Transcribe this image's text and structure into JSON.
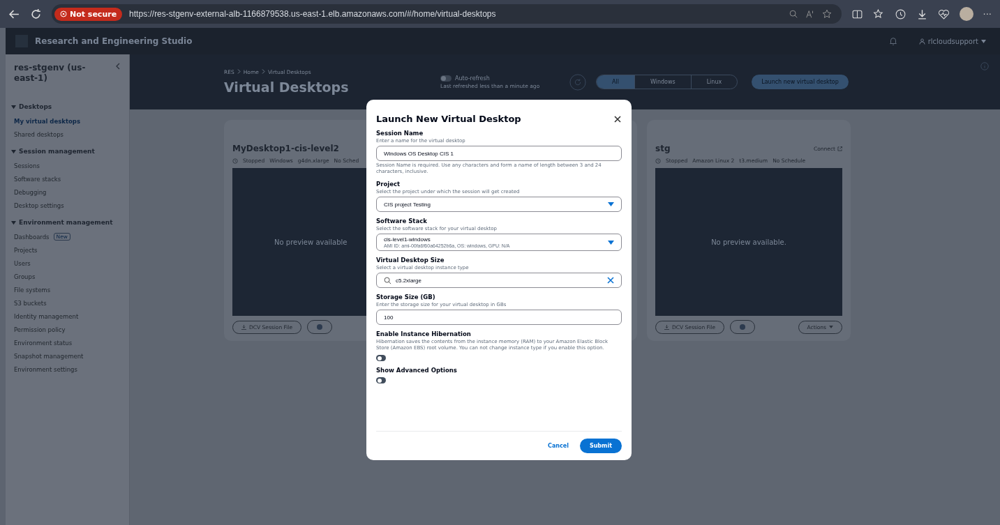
{
  "browser": {
    "security_badge": "Not secure",
    "url": "https://res-stgenv-external-alb-1166879538.us-east-1.elb.amazonaws.com/#/home/virtual-desktops",
    "more": "···"
  },
  "app_header": {
    "title": "Research and Engineering Studio",
    "user": "rlcloudsupport"
  },
  "sidebar": {
    "title": "res-stgenv (us-east-1)",
    "sections": [
      {
        "label": "Desktops",
        "expanded": true,
        "items": [
          {
            "label": "My virtual desktops",
            "selected": true
          },
          {
            "label": "Shared desktops",
            "selected": false
          }
        ]
      },
      {
        "label": "Session management",
        "expanded": true,
        "items": [
          {
            "label": "Sessions",
            "selected": false
          },
          {
            "label": "Software stacks",
            "selected": false
          },
          {
            "label": "Debugging",
            "selected": false
          },
          {
            "label": "Desktop settings",
            "selected": false
          }
        ]
      },
      {
        "label": "Environment management",
        "expanded": true,
        "items": [
          {
            "label": "Dashboards",
            "badge": "New",
            "selected": false
          },
          {
            "label": "Projects",
            "selected": false
          },
          {
            "label": "Users",
            "selected": false
          },
          {
            "label": "Groups",
            "selected": false
          },
          {
            "label": "File systems",
            "selected": false
          },
          {
            "label": "S3 buckets",
            "selected": false
          },
          {
            "label": "Identity management",
            "selected": false
          },
          {
            "label": "Permission policy",
            "selected": false
          },
          {
            "label": "Environment status",
            "selected": false
          },
          {
            "label": "Snapshot management",
            "selected": false
          },
          {
            "label": "Environment settings",
            "selected": false
          }
        ]
      }
    ]
  },
  "page": {
    "breadcrumb": [
      "RES",
      "Home",
      "Virtual Desktops"
    ],
    "title": "Virtual Desktops",
    "auto_refresh": {
      "label": "Auto-refresh",
      "note": "Last refreshed less than a minute ago",
      "on": false
    },
    "filters": [
      {
        "label": "All",
        "selected": true
      },
      {
        "label": "Windows",
        "selected": false
      },
      {
        "label": "Linux",
        "selected": false
      }
    ],
    "launch_button": "Launch new virtual desktop"
  },
  "desktops": [
    {
      "name": "MyDesktop1-cis-level2",
      "status": "Stopped",
      "meta": [
        "Windows",
        "g4dn.xlarge",
        "No Sched"
      ],
      "preview": "No preview available",
      "download": "DCV Session File"
    },
    {
      "name": "stg",
      "connect": "Connect",
      "status": "Stopped",
      "meta": [
        "Amazon Linux 2",
        "t3.medium",
        "No Schedule"
      ],
      "preview": "No preview available.",
      "download": "DCV Session File",
      "actions": "Actions"
    }
  ],
  "dialog": {
    "title": "Launch New Virtual Desktop",
    "fields": [
      {
        "kind": "text",
        "label": "Session Name",
        "description": "Enter a name for the virtual desktop",
        "value": "Windows OS Desktop CIS 1",
        "hint": "Session Name is required. Use any characters and form a name of length between 3 and 24 characters, inclusive."
      },
      {
        "kind": "select",
        "label": "Project",
        "description": "Select the project under which the session will get created",
        "value": "CIS project Testing"
      },
      {
        "kind": "select",
        "label": "Software Stack",
        "description": "Select the software stack for your virtual desktop",
        "value": "cis-level1-windows",
        "detail": "AMI ID: ami-00fa6f60a64252b6a, OS: windows, GPU: N/A"
      },
      {
        "kind": "search",
        "label": "Virtual Desktop Size",
        "description": "Select a virtual desktop instance type",
        "value": "c5.2xlarge"
      },
      {
        "kind": "text",
        "label": "Storage Size (GB)",
        "description": "Enter the storage size for your virtual desktop in GBs",
        "value": "100"
      },
      {
        "kind": "toggle",
        "label": "Enable Instance Hibernation",
        "description": "Hibernation saves the contents from the instance memory (RAM) to your Amazon Elastic Block Store (Amazon EBS) root volume. You can not change instance type if you enable this option.",
        "on": false
      },
      {
        "kind": "toggle",
        "label": "Show Advanced Options",
        "on": false
      }
    ],
    "cancel": "Cancel",
    "submit": "Submit"
  }
}
